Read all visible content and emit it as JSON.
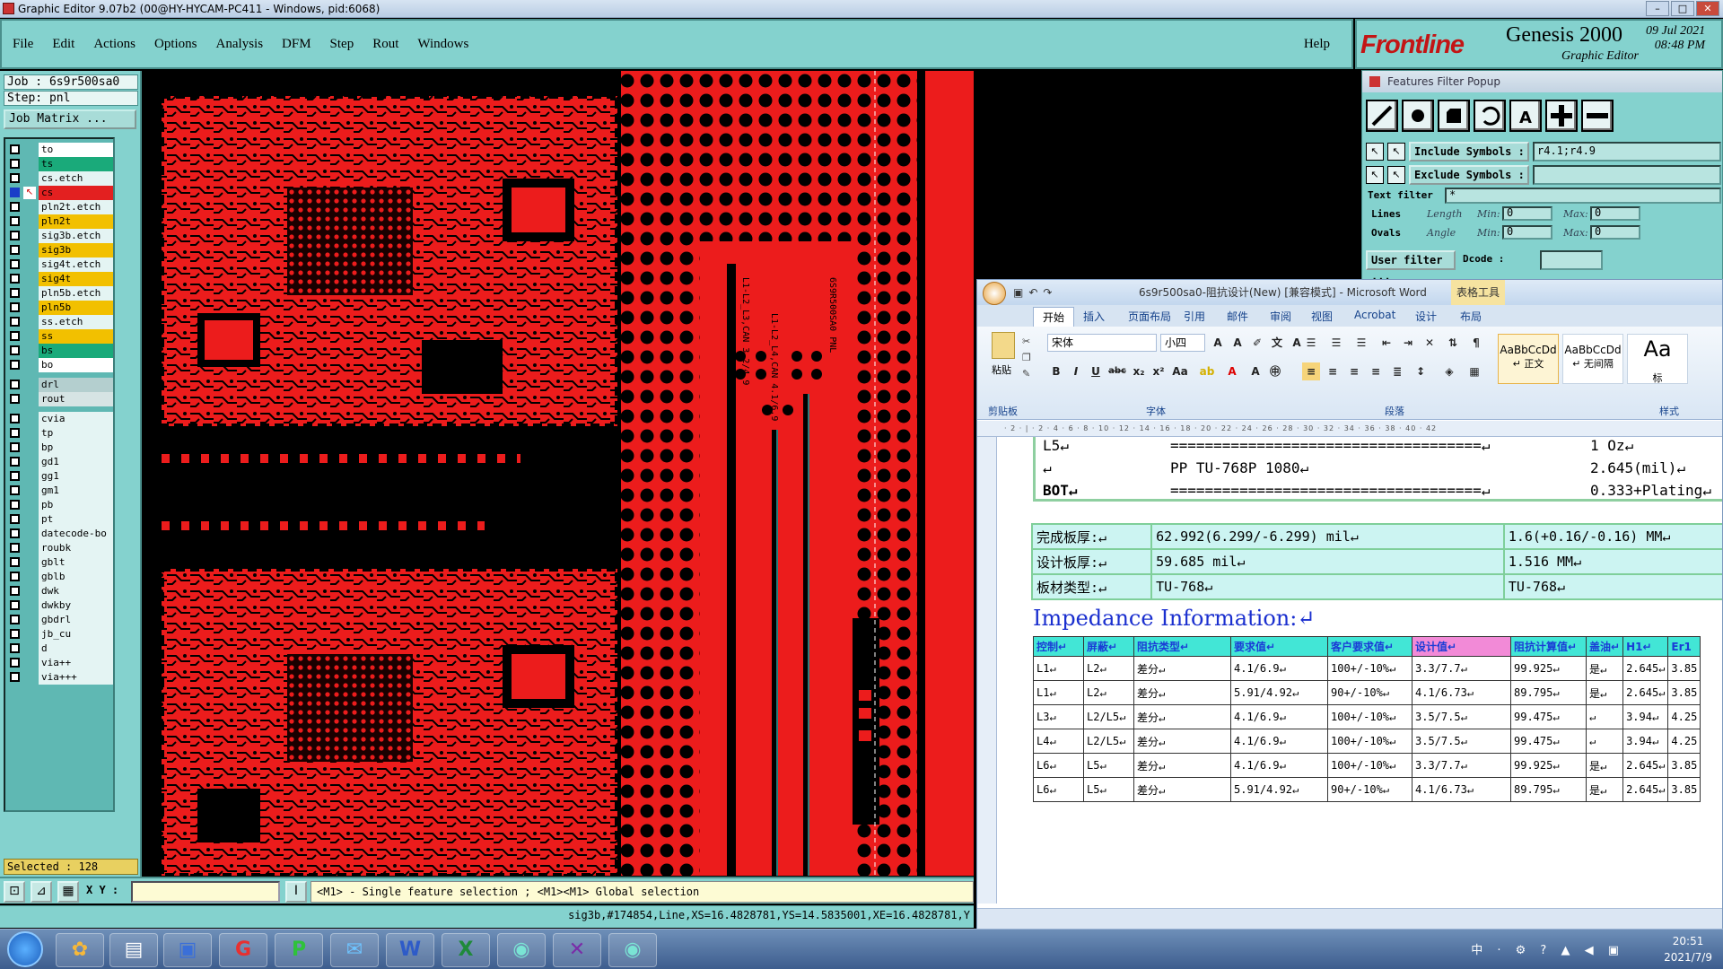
{
  "window": {
    "title": "Graphic Editor 9.07b2 (00@HY-HYCAM-PC411 - Windows, pid:6068)"
  },
  "menu": [
    "File",
    "Edit",
    "Actions",
    "Options",
    "Analysis",
    "DFM",
    "Step",
    "Rout",
    "Windows"
  ],
  "help": "Help",
  "brand": {
    "logo": "Frontline",
    "product": "Genesis 2000",
    "sub": "Graphic Editor",
    "date": "09 Jul 2021",
    "time": "08:48 PM"
  },
  "job": {
    "job_line": "Job : 6s9r500sa0",
    "step_line": "Step: pnl",
    "matrix_btn": "Job Matrix ..."
  },
  "layers": [
    {
      "name": "to",
      "color": "#ffffff",
      "on": false
    },
    {
      "name": "ts",
      "color": "#1aaa7a",
      "on": false
    },
    {
      "name": "cs.etch",
      "color": "#e4f4f3",
      "on": false
    },
    {
      "name": "cs",
      "color": "#e32020",
      "on": true
    },
    {
      "name": "pln2t.etch",
      "color": "#e4f4f3",
      "on": false
    },
    {
      "name": "pln2t",
      "color": "#f2c000",
      "on": false
    },
    {
      "name": "sig3b.etch",
      "color": "#e4f4f3",
      "on": false
    },
    {
      "name": "sig3b",
      "color": "#f2c000",
      "on": false
    },
    {
      "name": "sig4t.etch",
      "color": "#e4f4f3",
      "on": false
    },
    {
      "name": "sig4t",
      "color": "#f2c000",
      "on": false
    },
    {
      "name": "pln5b.etch",
      "color": "#e4f4f3",
      "on": false
    },
    {
      "name": "pln5b",
      "color": "#f2c000",
      "on": false
    },
    {
      "name": "ss.etch",
      "color": "#e4f4f3",
      "on": false
    },
    {
      "name": "ss",
      "color": "#f2c000",
      "on": false
    },
    {
      "name": "bs",
      "color": "#1aaa7a",
      "on": false
    },
    {
      "name": "bo",
      "color": "#ffffff",
      "on": false
    },
    {
      "name": "drl",
      "color": "#b4cfcf",
      "on": false
    },
    {
      "name": "rout",
      "color": "#d6e4e4",
      "on": false
    },
    {
      "name": "cvia",
      "color": "#e4f4f3",
      "on": false
    },
    {
      "name": "tp",
      "color": "#e4f4f3",
      "on": false
    },
    {
      "name": "bp",
      "color": "#e4f4f3",
      "on": false
    },
    {
      "name": "gd1",
      "color": "#e4f4f3",
      "on": false
    },
    {
      "name": "gg1",
      "color": "#e4f4f3",
      "on": false
    },
    {
      "name": "gm1",
      "color": "#e4f4f3",
      "on": false
    },
    {
      "name": "pb",
      "color": "#e4f4f3",
      "on": false
    },
    {
      "name": "pt",
      "color": "#e4f4f3",
      "on": false
    },
    {
      "name": "datecode-bo",
      "color": "#e4f4f3",
      "on": false
    },
    {
      "name": "roubk",
      "color": "#e4f4f3",
      "on": false
    },
    {
      "name": "gblt",
      "color": "#e4f4f3",
      "on": false
    },
    {
      "name": "gblb",
      "color": "#e4f4f3",
      "on": false
    },
    {
      "name": "dwk",
      "color": "#e4f4f3",
      "on": false
    },
    {
      "name": "dwkby",
      "color": "#e4f4f3",
      "on": false
    },
    {
      "name": "gbdrl",
      "color": "#e4f4f3",
      "on": false
    },
    {
      "name": "jb_cu",
      "color": "#e4f4f3",
      "on": false
    },
    {
      "name": "d",
      "color": "#e4f4f3",
      "on": false
    },
    {
      "name": "via++",
      "color": "#e4f4f3",
      "on": false
    },
    {
      "name": "via+++",
      "color": "#e4f4f3",
      "on": false
    }
  ],
  "selected": "Selected : 128",
  "status": {
    "xy_label": "X Y :",
    "hint": "<M1> - Single feature selection ; <M1><M1> Global selection",
    "info": "sig3b,#174854,Line,XS=16.4828781,YS=14.5835001,XE=16.4828781,Y"
  },
  "pcb": {
    "text1": "L1-L2_L3,CAN 3.2/4.9",
    "text2": "L1-L2_L4,CAN 4.1/6.9",
    "text3": "6S9R500SA0 PNL"
  },
  "filter": {
    "title": "Features Filter Popup",
    "include_label": "Include Symbols :",
    "include_value": "r4.1;r4.9",
    "exclude_label": "Exclude Symbols :",
    "exclude_value": "",
    "text_filter_label": "Text filter",
    "text_filter_value": "*",
    "lines": "Lines",
    "ovals": "Ovals",
    "length": "Length",
    "angle": "Angle",
    "min": "Min:",
    "max": "Max:",
    "zero": "0",
    "user_filter": "User filter ...",
    "dcode": "Dcode :"
  },
  "word": {
    "title": "6s9r500sa0-阻抗设计(New) [兼容模式] - Microsoft Word",
    "tools": "表格工具",
    "tabs": [
      "开始",
      "插入",
      "页面布局",
      "引用",
      "邮件",
      "审阅",
      "视图",
      "Acrobat",
      "设计",
      "布局"
    ],
    "font": "宋体",
    "size": "小四",
    "groups": [
      "剪贴板",
      "字体",
      "段落",
      "样式"
    ],
    "paste": "粘贴",
    "styles": [
      {
        "sample": "AaBbCcDd",
        "name": "↵ 正文"
      },
      {
        "sample": "AaBbCcDd",
        "name": "↵ 无间隔"
      },
      {
        "sample": "Aa",
        "name": "标"
      }
    ],
    "stack": [
      {
        "a": "L5↵",
        "b": "====================================↵",
        "c": "1 Oz↵"
      },
      {
        "a": "↵",
        "b": "PP     TU-768P    1080↵",
        "c": "2.645(mil)↵"
      },
      {
        "a": "BOT↵",
        "b": "====================================↵",
        "c": "0.333+Plating↵"
      }
    ],
    "board": [
      [
        "完成板厚:↵",
        "62.992(6.299/-6.299) mil↵",
        "1.6(+0.16/-0.16) MM↵"
      ],
      [
        "设计板厚:↵",
        "59.685 mil↵",
        "1.516 MM↵"
      ],
      [
        "板材类型:↵",
        "TU-768↵",
        "TU-768↵"
      ]
    ],
    "imp_title": "Impedance Information:↵",
    "imp_headers": [
      "控制↵",
      "屏蔽↵",
      "阻抗类型↵",
      "要求值↵",
      "客户要求值↵",
      "设计值↵",
      "阻抗计算值↵",
      "盖油↵",
      "H1↵",
      "Er1"
    ],
    "imp_rows": [
      [
        "L1↵",
        "L2↵",
        "差分↵",
        "4.1/6.9↵",
        "100+/-10%↵",
        "3.3/7.7↵",
        "99.925↵",
        "是↵",
        "2.645↵",
        "3.85"
      ],
      [
        "L1↵",
        "L2↵",
        "差分↵",
        "5.91/4.92↵",
        "90+/-10%↵",
        "4.1/6.73↵",
        "89.795↵",
        "是↵",
        "2.645↵",
        "3.85"
      ],
      [
        "L3↵",
        "L2/L5↵",
        "差分↵",
        "4.1/6.9↵",
        "100+/-10%↵",
        "3.5/7.5↵",
        "99.475↵",
        "↵",
        "3.94↵",
        "4.25"
      ],
      [
        "L4↵",
        "L2/L5↵",
        "差分↵",
        "4.1/6.9↵",
        "100+/-10%↵",
        "3.5/7.5↵",
        "99.475↵",
        "↵",
        "3.94↵",
        "4.25"
      ],
      [
        "L6↵",
        "L5↵",
        "差分↵",
        "4.1/6.9↵",
        "100+/-10%↵",
        "3.3/7.7↵",
        "99.925↵",
        "是↵",
        "2.645↵",
        "3.85"
      ],
      [
        "L6↵",
        "L5↵",
        "差分↵",
        "5.91/4.92↵",
        "90+/-10%↵",
        "4.1/6.73↵",
        "89.795↵",
        "是↵",
        "2.645↵",
        "3.85"
      ]
    ],
    "ruler": "· 2 · | · 2 · 4 · 6 · 8 · 10 · 12 · 14 · 16 · 18 · 20 · 22 · 24 · 26 · 28 · 30 · 32 · 34 · 36 · 38 · 40 · 42"
  },
  "taskbar": {
    "time": "20:51",
    "date": "2021/7/9",
    "tray": "中 · ⚙ ? ▲ ◀ ▣"
  }
}
